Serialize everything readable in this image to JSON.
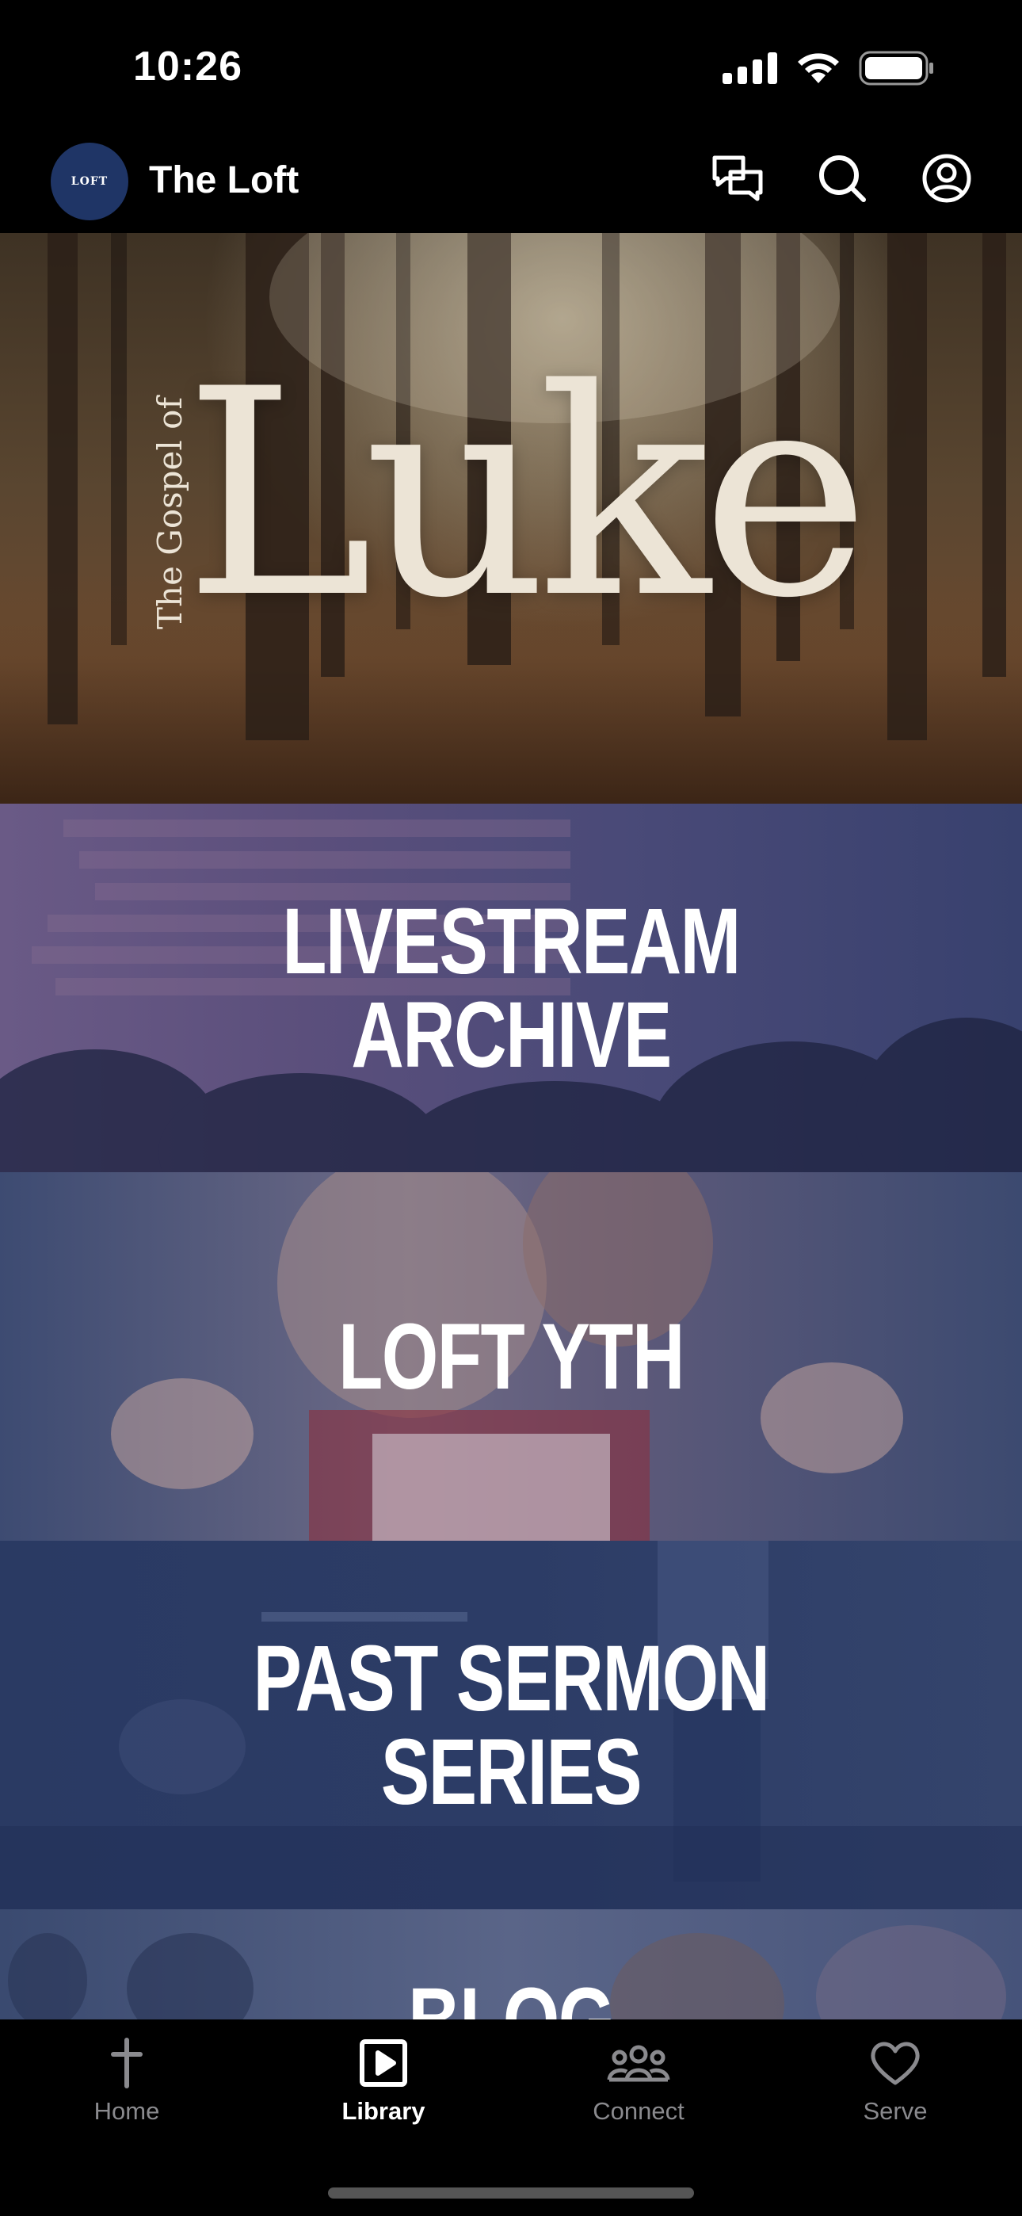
{
  "status_bar": {
    "time": "10:26"
  },
  "header": {
    "avatar_text": "LOFT",
    "title": "The Loft",
    "actions": [
      "chat-icon",
      "search-icon",
      "account-icon"
    ]
  },
  "hero": {
    "small_text": "The Gospel of",
    "big_text": "Luke",
    "slides_total": 5,
    "active_slide": 1
  },
  "library": {
    "tiles": [
      {
        "label": "LIVESTREAM\nARCHIVE"
      },
      {
        "label": "LOFT YTH"
      },
      {
        "label": "PAST SERMON\nSERIES"
      },
      {
        "label": "BLOG"
      }
    ]
  },
  "tab_bar": {
    "tabs": [
      {
        "label": "Home",
        "icon": "cross-icon",
        "active": false
      },
      {
        "label": "Library",
        "icon": "play-square-icon",
        "active": true
      },
      {
        "label": "Connect",
        "icon": "people-icon",
        "active": false
      },
      {
        "label": "Serve",
        "icon": "heart-icon",
        "active": false
      }
    ]
  }
}
